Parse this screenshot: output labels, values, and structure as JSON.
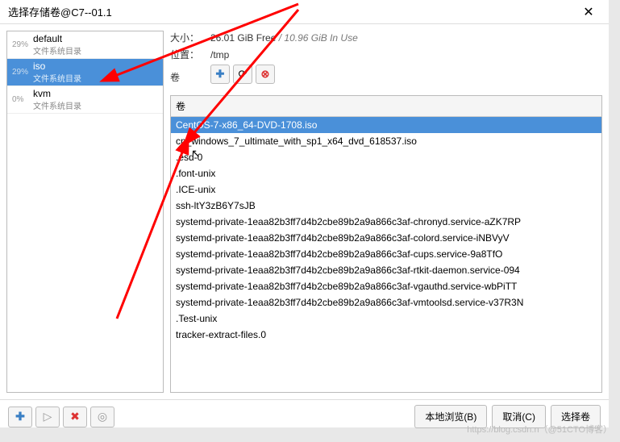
{
  "window": {
    "title": "选择存储卷@C7--01.1",
    "close": "✕"
  },
  "pools": [
    {
      "pct": "29%",
      "name": "default",
      "sub": "文件系统目录",
      "selected": false
    },
    {
      "pct": "29%",
      "name": "iso",
      "sub": "文件系统目录",
      "selected": true
    },
    {
      "pct": "0%",
      "name": "kvm",
      "sub": "文件系统目录",
      "selected": false
    }
  ],
  "info": {
    "size_label": "大小：",
    "size_free": "26.01 GiB Free",
    "size_sep": " / ",
    "size_used": "10.96 GiB In Use",
    "loc_label": "位置：",
    "loc_val": "/tmp",
    "vol_label": "卷"
  },
  "toolbar": {
    "plus": "✚",
    "refresh": "⟳",
    "delete": "⊗"
  },
  "vol_header": "卷",
  "vols": [
    {
      "name": "CentOS-7-x86_64-DVD-1708.iso",
      "selected": true
    },
    {
      "name": "cn_windows_7_ultimate_with_sp1_x64_dvd_618537.iso",
      "selected": false
    },
    {
      "name": ".esd-0",
      "selected": false
    },
    {
      "name": ".font-unix",
      "selected": false
    },
    {
      "name": ".ICE-unix",
      "selected": false
    },
    {
      "name": "ssh-ltY3zB6Y7sJB",
      "selected": false
    },
    {
      "name": "systemd-private-1eaa82b3ff7d4b2cbe89b2a9a866c3af-chronyd.service-aZK7RP",
      "selected": false
    },
    {
      "name": "systemd-private-1eaa82b3ff7d4b2cbe89b2a9a866c3af-colord.service-iNBVyV",
      "selected": false
    },
    {
      "name": "systemd-private-1eaa82b3ff7d4b2cbe89b2a9a866c3af-cups.service-9a8TfO",
      "selected": false
    },
    {
      "name": "systemd-private-1eaa82b3ff7d4b2cbe89b2a9a866c3af-rtkit-daemon.service-094",
      "selected": false
    },
    {
      "name": "systemd-private-1eaa82b3ff7d4b2cbe89b2a9a866c3af-vgauthd.service-wbPiTT",
      "selected": false
    },
    {
      "name": "systemd-private-1eaa82b3ff7d4b2cbe89b2a9a866c3af-vmtoolsd.service-v37R3N",
      "selected": false
    },
    {
      "name": ".Test-unix",
      "selected": false
    },
    {
      "name": "tracker-extract-files.0",
      "selected": false
    }
  ],
  "footer": {
    "plus": "✚",
    "play": "▷",
    "del": "✖",
    "circ": "◎",
    "browse": "本地浏览(B)",
    "cancel": "取消(C)",
    "select": "选择卷"
  },
  "watermark": "https://blog.csdn.n（@51CTO博客）"
}
